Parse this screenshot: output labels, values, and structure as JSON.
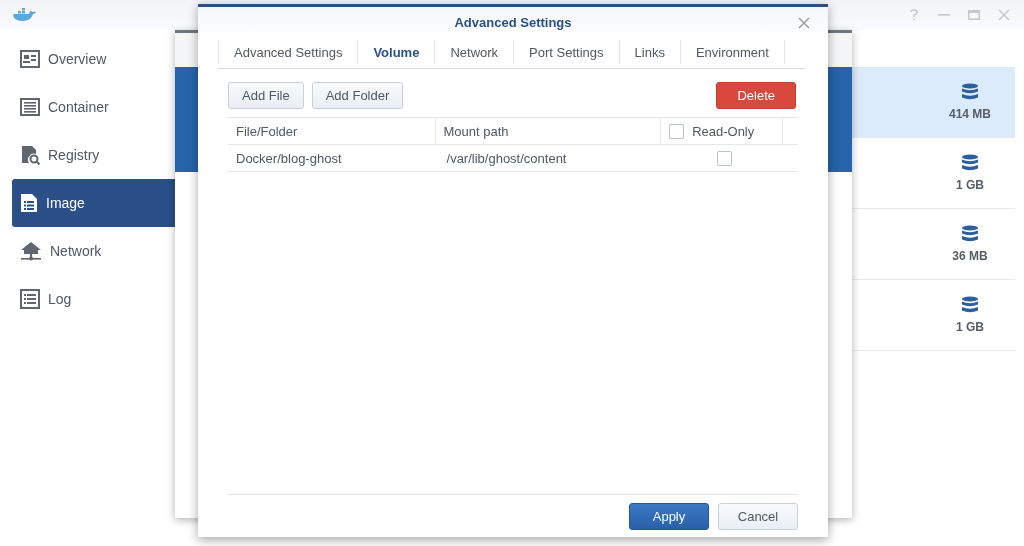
{
  "sidebar": {
    "items": [
      {
        "label": "Overview",
        "selected": false
      },
      {
        "label": "Container",
        "selected": false
      },
      {
        "label": "Registry",
        "selected": false
      },
      {
        "label": "Image",
        "selected": true
      },
      {
        "label": "Network",
        "selected": false
      },
      {
        "label": "Log",
        "selected": false
      }
    ]
  },
  "image_list": {
    "rows": [
      {
        "size": "414 MB",
        "selected": true
      },
      {
        "size": "1 GB",
        "selected": false
      },
      {
        "size": "36 MB",
        "selected": false
      },
      {
        "size": "1 GB",
        "selected": false
      }
    ]
  },
  "dialog": {
    "title": "Advanced Settings",
    "tabs": [
      {
        "label": "Advanced Settings",
        "selected": false
      },
      {
        "label": "Volume",
        "selected": true
      },
      {
        "label": "Network",
        "selected": false
      },
      {
        "label": "Port Settings",
        "selected": false
      },
      {
        "label": "Links",
        "selected": false
      },
      {
        "label": "Environment",
        "selected": false
      }
    ],
    "toolbar": {
      "buttons": [
        "Add File",
        "Add Folder"
      ],
      "delete": "Delete"
    },
    "table": {
      "columns": [
        "File/Folder",
        "Mount path",
        "Read-Only"
      ],
      "read_only_all_checked": false,
      "rows": [
        {
          "file_folder": "Docker/blog-ghost",
          "mount_path": "/var/lib/ghost/content",
          "read_only": false
        }
      ]
    },
    "footer": {
      "apply": "Apply",
      "cancel": "Cancel"
    }
  }
}
